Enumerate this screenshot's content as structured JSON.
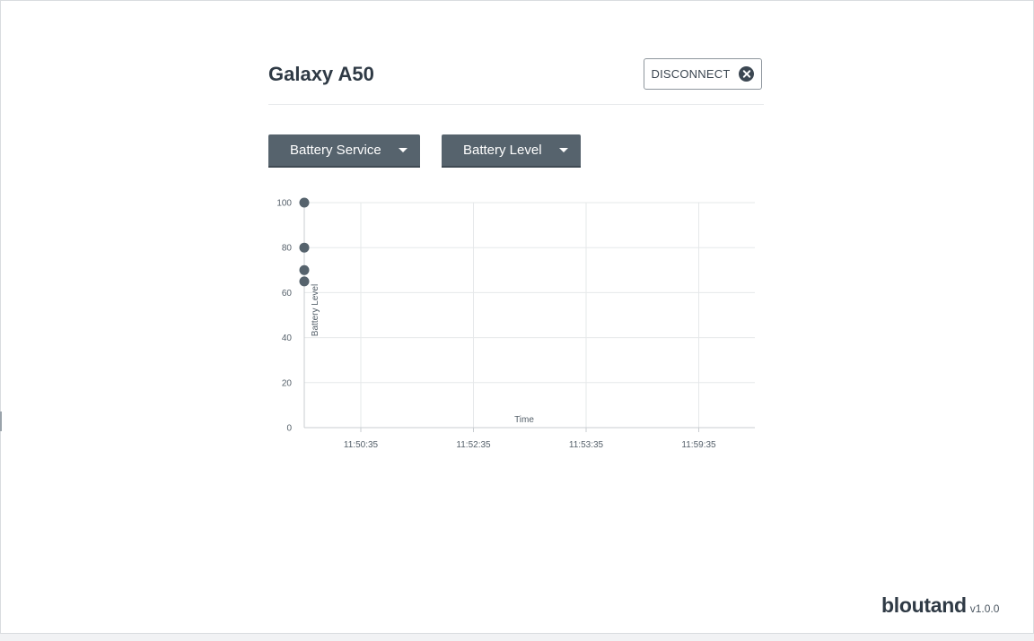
{
  "device": {
    "name": "Galaxy A50"
  },
  "header": {
    "disconnect_label": "DISCONNECT"
  },
  "selectors": {
    "service": "Battery Service",
    "characteristic": "Battery Level"
  },
  "chart_data": {
    "type": "scatter",
    "title": "",
    "xlabel": "Time",
    "ylabel": "Battery Level",
    "ylim": [
      0,
      100
    ],
    "yticks": [
      0,
      20,
      40,
      60,
      80,
      100
    ],
    "xticks": [
      "11:50:35",
      "11:52:35",
      "11:53:35",
      "11:59:35"
    ],
    "grid": true,
    "legend": "none",
    "series": [
      {
        "points": [
          {
            "y": 100
          },
          {
            "y": 80
          },
          {
            "y": 70
          },
          {
            "y": 65
          }
        ]
      }
    ]
  },
  "footer": {
    "brand": "bloutand",
    "version": "v1.0.0"
  },
  "colors": {
    "accent": "#56636d",
    "marker": "#56636d",
    "text": "#2f3a45",
    "grid": "#e6e8ea"
  }
}
